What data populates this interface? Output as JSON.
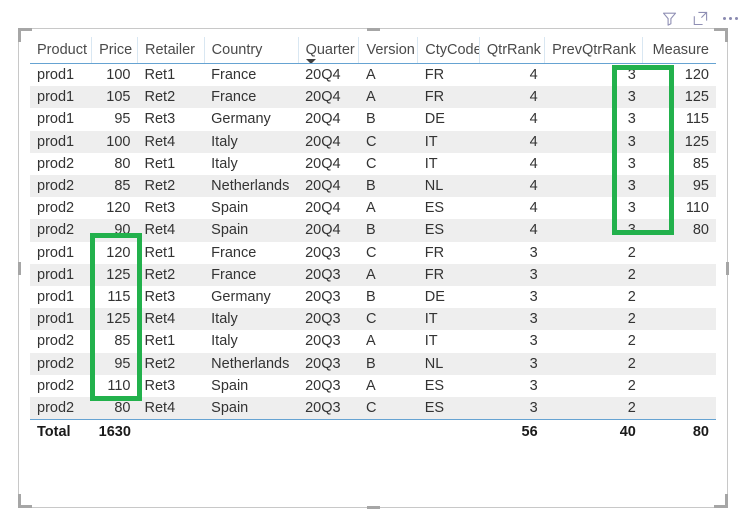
{
  "visual": {
    "type": "table-visual",
    "actions": [
      {
        "name": "filter-icon",
        "label": "Filters"
      },
      {
        "name": "focus-mode-icon",
        "label": "Focus mode"
      },
      {
        "name": "more-options-icon",
        "label": "More options"
      }
    ]
  },
  "table": {
    "columns": [
      {
        "key": "product",
        "label": "Product",
        "align": "left"
      },
      {
        "key": "price",
        "label": "Price",
        "align": "right"
      },
      {
        "key": "retailer",
        "label": "Retailer",
        "align": "left"
      },
      {
        "key": "country",
        "label": "Country",
        "align": "left"
      },
      {
        "key": "quarter",
        "label": "Quarter",
        "align": "left",
        "sorted": "desc"
      },
      {
        "key": "version",
        "label": "Version",
        "align": "left"
      },
      {
        "key": "ctycode",
        "label": "CtyCode",
        "align": "left"
      },
      {
        "key": "qtrrank",
        "label": "QtrRank",
        "align": "right"
      },
      {
        "key": "prevqtrrank",
        "label": "PrevQtrRank",
        "align": "right"
      },
      {
        "key": "measure",
        "label": "Measure",
        "align": "right"
      }
    ],
    "rows": [
      [
        "prod1",
        "100",
        "Ret1",
        "France",
        "20Q4",
        "A",
        "FR",
        "4",
        "3",
        "120"
      ],
      [
        "prod1",
        "105",
        "Ret2",
        "France",
        "20Q4",
        "A",
        "FR",
        "4",
        "3",
        "125"
      ],
      [
        "prod1",
        "95",
        "Ret3",
        "Germany",
        "20Q4",
        "B",
        "DE",
        "4",
        "3",
        "115"
      ],
      [
        "prod1",
        "100",
        "Ret4",
        "Italy",
        "20Q4",
        "C",
        "IT",
        "4",
        "3",
        "125"
      ],
      [
        "prod2",
        "80",
        "Ret1",
        "Italy",
        "20Q4",
        "C",
        "IT",
        "4",
        "3",
        "85"
      ],
      [
        "prod2",
        "85",
        "Ret2",
        "Netherlands",
        "20Q4",
        "B",
        "NL",
        "4",
        "3",
        "95"
      ],
      [
        "prod2",
        "120",
        "Ret3",
        "Spain",
        "20Q4",
        "A",
        "ES",
        "4",
        "3",
        "110"
      ],
      [
        "prod2",
        "90",
        "Ret4",
        "Spain",
        "20Q4",
        "B",
        "ES",
        "4",
        "3",
        "80"
      ],
      [
        "prod1",
        "120",
        "Ret1",
        "France",
        "20Q3",
        "C",
        "FR",
        "3",
        "2",
        ""
      ],
      [
        "prod1",
        "125",
        "Ret2",
        "France",
        "20Q3",
        "A",
        "FR",
        "3",
        "2",
        ""
      ],
      [
        "prod1",
        "115",
        "Ret3",
        "Germany",
        "20Q3",
        "B",
        "DE",
        "3",
        "2",
        ""
      ],
      [
        "prod1",
        "125",
        "Ret4",
        "Italy",
        "20Q3",
        "C",
        "IT",
        "3",
        "2",
        ""
      ],
      [
        "prod2",
        "85",
        "Ret1",
        "Italy",
        "20Q3",
        "A",
        "IT",
        "3",
        "2",
        ""
      ],
      [
        "prod2",
        "95",
        "Ret2",
        "Netherlands",
        "20Q3",
        "B",
        "NL",
        "3",
        "2",
        ""
      ],
      [
        "prod2",
        "110",
        "Ret3",
        "Spain",
        "20Q3",
        "A",
        "ES",
        "3",
        "2",
        ""
      ],
      [
        "prod2",
        "80",
        "Ret4",
        "Spain",
        "20Q3",
        "C",
        "ES",
        "3",
        "2",
        ""
      ]
    ],
    "total": [
      "Total",
      "1630",
      "",
      "",
      "",
      "",
      "",
      "56",
      "40",
      "80"
    ]
  },
  "annotations": [
    {
      "name": "measure-column-highlight",
      "color": "#22b14c"
    },
    {
      "name": "price-column-highlight",
      "color": "#22b14c"
    }
  ]
}
